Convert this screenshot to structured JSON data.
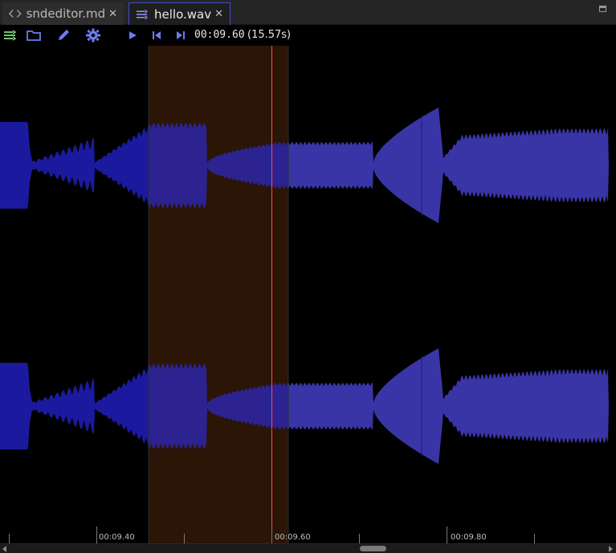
{
  "tabs": [
    {
      "label": "sndeditor.md",
      "icon": "code-icon",
      "active": false
    },
    {
      "label": "hello.wav",
      "icon": "audio-waves-icon",
      "active": true
    }
  ],
  "toolbar": {
    "icons": [
      "waves-tool-icon",
      "folder-icon",
      "pencil-icon",
      "gear-icon",
      "play-icon",
      "skip-start-icon",
      "skip-end-icon"
    ],
    "time": "00:09.60",
    "duration": "(15.57s)"
  },
  "ruler": {
    "labels": [
      "00:09.40",
      "00:09.60",
      "00:09.80"
    ]
  },
  "colors": {
    "wave_dim": "#1b1a9e",
    "wave_bright": "#3a35a6",
    "selection": "#2b1507",
    "playhead": "#ff4b4b",
    "accent": "#4b5df0",
    "toolbar_green": "#7de37d"
  },
  "playback": {
    "selection_start": "00:09.52",
    "selection_end": "00:09.68",
    "playhead": "00:09.60"
  }
}
